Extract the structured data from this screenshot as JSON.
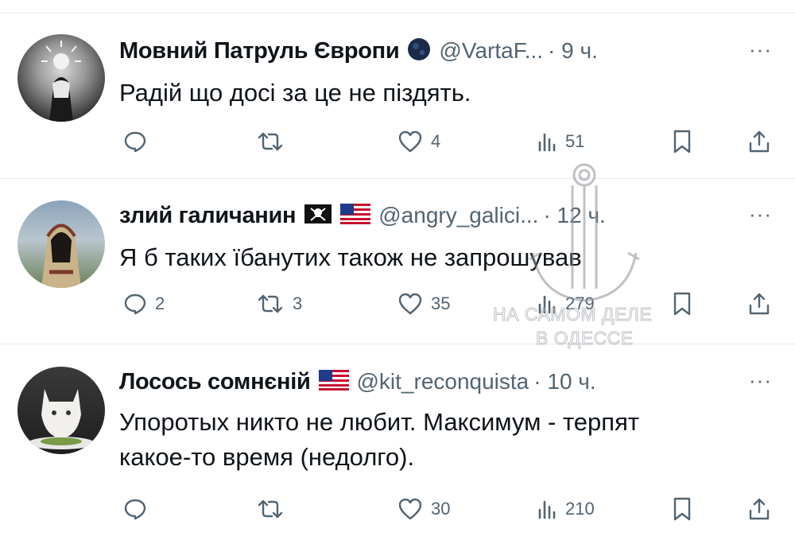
{
  "tweets": [
    {
      "name": "Мовний Патруль Європи",
      "handle": "@VartaF...",
      "time": "· 9 ч.",
      "more": "···",
      "text": "Радій що досі за це не піздять.",
      "badges": [
        "globe-icon"
      ],
      "replies": "",
      "reposts": "",
      "likes": "4",
      "views": "51"
    },
    {
      "name": "злий галичанин",
      "handle": "@angry_galici...",
      "time": "· 12 ч.",
      "more": "···",
      "text": "Я б таких їбанутих також не запрошував",
      "badges": [
        "pirate-flag-icon",
        "us-flag-icon"
      ],
      "replies": "2",
      "reposts": "3",
      "likes": "35",
      "views": "279"
    },
    {
      "name": "Лосось сомнєній",
      "handle": "@kit_reconquista",
      "time": "· 10 ч.",
      "more": "···",
      "text": "Упоротых никто не любит. Максимум - терпят\nкакое-то время (недолго).",
      "badges": [
        "us-flag-icon"
      ],
      "replies": "",
      "reposts": "",
      "likes": "30",
      "views": "210"
    }
  ],
  "watermark": {
    "line1": "НА САМОМ ДЕЛЕ",
    "line2": "В ОДЕССЕ"
  },
  "colors": {
    "text": "#0f1419",
    "secondary": "#536471",
    "divider": "#e6e9ec"
  }
}
